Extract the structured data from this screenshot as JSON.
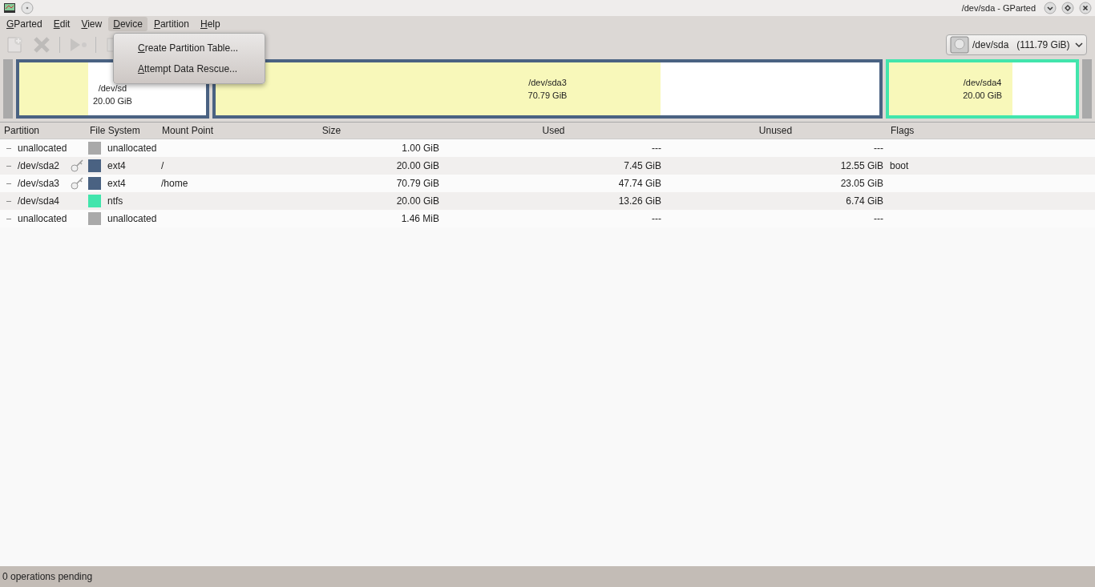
{
  "window": {
    "title": "/dev/sda - GParted"
  },
  "menu": [
    {
      "label": "GParted",
      "selected": false
    },
    {
      "label": "Edit",
      "selected": false
    },
    {
      "label": "View",
      "selected": false
    },
    {
      "label": "Device",
      "selected": true
    },
    {
      "label": "Partition",
      "selected": false
    },
    {
      "label": "Help",
      "selected": false
    }
  ],
  "dropdown_menu": [
    "Create Partition Table...",
    "Attempt Data Rescue..."
  ],
  "toolbar": [
    {
      "kind": "new",
      "disabled": true
    },
    {
      "kind": "delete",
      "disabled": true
    },
    {
      "kind": "sep"
    },
    {
      "kind": "resize",
      "disabled": true
    },
    {
      "kind": "sep"
    },
    {
      "kind": "copy",
      "disabled": true
    }
  ],
  "device_selector": {
    "device": "/dev/sda",
    "size": "(111.79 GiB)"
  },
  "disk_map": [
    {
      "kind": "unallocated"
    },
    {
      "kind": "partition",
      "name": "/dev/sd",
      "size": "20.00 GiB",
      "color": "#4a6282",
      "level": 0.37
    },
    {
      "kind": "partition",
      "name": "/dev/sda3",
      "size": "70.79 GiB",
      "color": "#4a6282",
      "level": 0.67
    },
    {
      "kind": "partition",
      "name": "/dev/sda4",
      "size": "20.00 GiB",
      "color": "#42e5ac",
      "level": 0.66
    },
    {
      "kind": "unallocated"
    }
  ],
  "table": {
    "columns": [
      "Partition",
      "File System",
      "Mount Point",
      "Size",
      "Used",
      "Unused",
      "Flags"
    ],
    "rows": [
      {
        "partition": "unallocated",
        "mounted": false,
        "color": "#a9a9a9",
        "file_system": "unallocated",
        "mount_point": "",
        "size": "1.00 GiB",
        "used": "---",
        "unused": "---",
        "flags": ""
      },
      {
        "partition": "/dev/sda2",
        "mounted": true,
        "color": "#4a6282",
        "file_system": "ext4",
        "mount_point": "/",
        "size": "20.00 GiB",
        "used": "7.45 GiB",
        "unused": "12.55 GiB",
        "flags": "boot"
      },
      {
        "partition": "/dev/sda3",
        "mounted": true,
        "color": "#4a6282",
        "file_system": "ext4",
        "mount_point": "/home",
        "size": "70.79 GiB",
        "used": "47.74 GiB",
        "unused": "23.05 GiB",
        "flags": ""
      },
      {
        "partition": "/dev/sda4",
        "mounted": false,
        "color": "#42e5ac",
        "file_system": "ntfs",
        "mount_point": "",
        "size": "20.00 GiB",
        "used": "13.26 GiB",
        "unused": "6.74 GiB",
        "flags": ""
      },
      {
        "partition": "unallocated",
        "mounted": false,
        "color": "#a9a9a9",
        "file_system": "unallocated",
        "mount_point": "",
        "size": "1.46 MiB",
        "used": "---",
        "unused": "---",
        "flags": ""
      }
    ]
  },
  "status_bar": "0 operations pending"
}
